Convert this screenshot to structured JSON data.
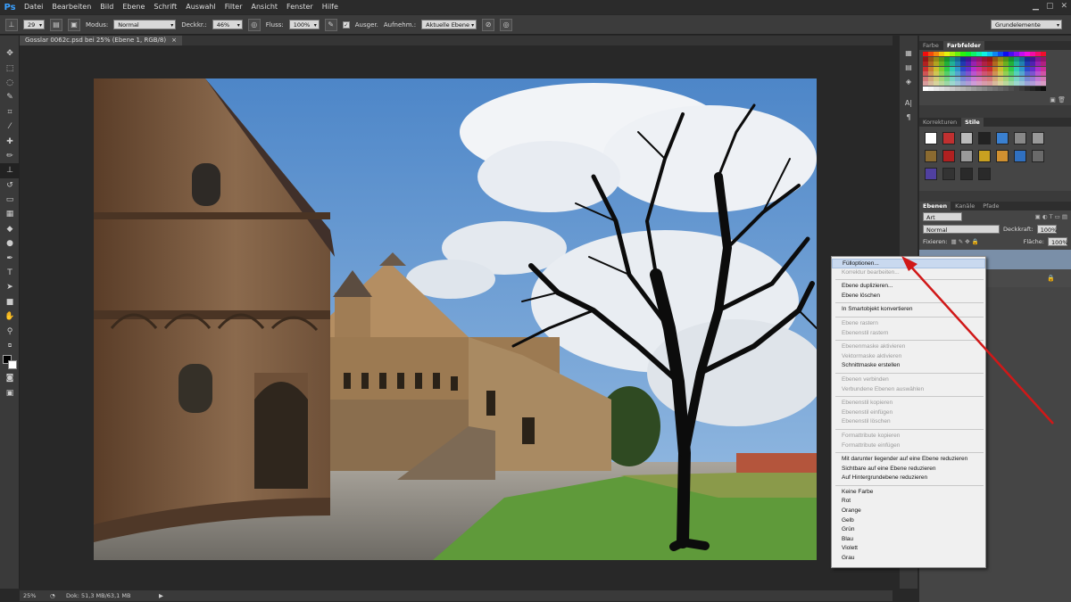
{
  "app": {
    "logo": "Ps"
  },
  "menubar": {
    "items": [
      "Datei",
      "Bearbeiten",
      "Bild",
      "Ebene",
      "Schrift",
      "Auswahl",
      "Filter",
      "Ansicht",
      "Fenster",
      "Hilfe"
    ]
  },
  "options": {
    "brush_size": "29",
    "mode_label": "Modus:",
    "mode_value": "Normal",
    "opacity_label": "Deckkr.:",
    "opacity_value": "46%",
    "flow_label": "Fluss:",
    "flow_value": "100%",
    "sample_all_label": "Ausger.",
    "sample_label": "Aufnehm.:",
    "sample_value": "Aktuelle Ebene",
    "workspace": "Grundelemente"
  },
  "document": {
    "tab_title": "Gosslar 0062c.psd bei 25% (Ebene 1, RGB/8)",
    "close": "×"
  },
  "status": {
    "zoom": "25%",
    "doc_info": "Dok: 51,3 MB/63,1 MB"
  },
  "panels": {
    "color_tabs": [
      "Farbe",
      "Farbfelder"
    ],
    "adjust_tabs": [
      "Korrekturen",
      "Stile"
    ],
    "layer_tabs": [
      "Ebenen",
      "Kanäle",
      "Pfade"
    ],
    "filter_value": "Art",
    "blend_mode": "Normal",
    "opacity_label": "Deckkraft:",
    "opacity_value": "100%",
    "lock_label": "Fixieren:",
    "fill_label": "Fläche:",
    "fill_value": "100%"
  },
  "context_menu": {
    "items": [
      {
        "label": "Fülloptionen...",
        "state": "highlight"
      },
      {
        "label": "Korrektur bearbeiten...",
        "state": "disabled"
      },
      {
        "sep": true
      },
      {
        "label": "Ebene duplizieren...",
        "state": "enabled"
      },
      {
        "label": "Ebene löschen",
        "state": "enabled"
      },
      {
        "sep": true
      },
      {
        "label": "In Smartobjekt konvertieren",
        "state": "enabled"
      },
      {
        "sep": true
      },
      {
        "label": "Ebene rastern",
        "state": "disabled"
      },
      {
        "label": "Ebenenstil rastern",
        "state": "disabled"
      },
      {
        "sep": true
      },
      {
        "label": "Ebenenmaske aktivieren",
        "state": "disabled"
      },
      {
        "label": "Vektormaske aktivieren",
        "state": "disabled"
      },
      {
        "label": "Schnittmaske erstellen",
        "state": "enabled"
      },
      {
        "sep": true
      },
      {
        "label": "Ebenen verbinden",
        "state": "disabled"
      },
      {
        "label": "Verbundene Ebenen auswählen",
        "state": "disabled"
      },
      {
        "sep": true
      },
      {
        "label": "Ebenenstil kopieren",
        "state": "disabled"
      },
      {
        "label": "Ebenenstil einfügen",
        "state": "disabled"
      },
      {
        "label": "Ebenenstil löschen",
        "state": "disabled"
      },
      {
        "sep": true
      },
      {
        "label": "Formattribute kopieren",
        "state": "disabled"
      },
      {
        "label": "Formattribute einfügen",
        "state": "disabled"
      },
      {
        "sep": true
      },
      {
        "label": "Mit darunter liegender auf eine Ebene reduzieren",
        "state": "enabled"
      },
      {
        "label": "Sichtbare auf eine Ebene reduzieren",
        "state": "enabled"
      },
      {
        "label": "Auf Hintergrundebene reduzieren",
        "state": "enabled"
      },
      {
        "sep": true
      },
      {
        "label": "Keine Farbe",
        "state": "enabled"
      },
      {
        "label": "Rot",
        "state": "enabled"
      },
      {
        "label": "Orange",
        "state": "enabled"
      },
      {
        "label": "Gelb",
        "state": "enabled"
      },
      {
        "label": "Grün",
        "state": "enabled"
      },
      {
        "label": "Blau",
        "state": "enabled"
      },
      {
        "label": "Violett",
        "state": "enabled"
      },
      {
        "label": "Grau",
        "state": "enabled"
      }
    ]
  },
  "colors": {
    "arrow": "#d01818",
    "menu_highlight": "#c9d9ef"
  }
}
